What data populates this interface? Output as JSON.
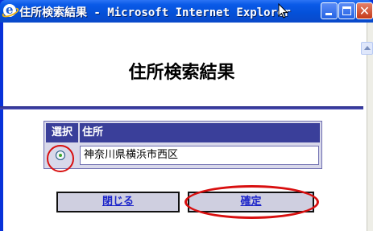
{
  "window": {
    "title": "住所検索結果 - Microsoft Internet Explorer",
    "controls": [
      "minimize",
      "maximize",
      "close"
    ]
  },
  "page": {
    "heading": "住所検索結果"
  },
  "table": {
    "headers": [
      "選択",
      "住所"
    ],
    "rows": [
      {
        "selected": true,
        "address": "神奈川県横浜市西区"
      }
    ]
  },
  "buttons": {
    "close_label": "閉じる",
    "confirm_label": "確定"
  },
  "icons": [
    "ie-icon",
    "mouse-cursor-icon",
    "minimize-icon",
    "maximize-icon",
    "close-icon",
    "scroll-up-icon"
  ],
  "colors": {
    "titlebar": "#0450d8",
    "header_fill": "#3a3f9a",
    "rule": "#3a3f9a",
    "highlight": "#d80f0f",
    "button_text": "#1a23c9"
  }
}
